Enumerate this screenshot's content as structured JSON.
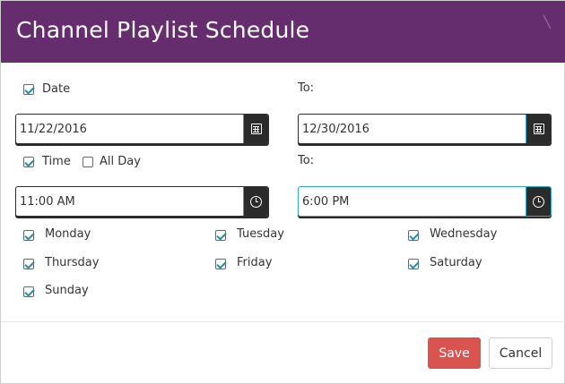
{
  "colors": {
    "brand": "#662d6e",
    "danger": "#d9534f",
    "check": "#2b8aa0"
  },
  "dialog": {
    "title": "Channel Playlist Schedule",
    "close_icon": "close-icon"
  },
  "date": {
    "label": "Date",
    "checked": true,
    "to_label": "To:",
    "from": "11/22/2016",
    "to": "12/30/2016",
    "icon": "calendar-icon"
  },
  "time": {
    "label": "Time",
    "checked": true,
    "all_day_label": "All Day",
    "all_day_checked": false,
    "to_label": "To:",
    "from": "11:00 AM",
    "to": "6:00 PM",
    "icon": "clock-icon"
  },
  "days": [
    {
      "label": "Monday",
      "checked": true
    },
    {
      "label": "Tuesday",
      "checked": true
    },
    {
      "label": "Wednesday",
      "checked": true
    },
    {
      "label": "Thursday",
      "checked": true
    },
    {
      "label": "Friday",
      "checked": true
    },
    {
      "label": "Saturday",
      "checked": true
    },
    {
      "label": "Sunday",
      "checked": true
    }
  ],
  "footer": {
    "save_label": "Save",
    "cancel_label": "Cancel"
  }
}
